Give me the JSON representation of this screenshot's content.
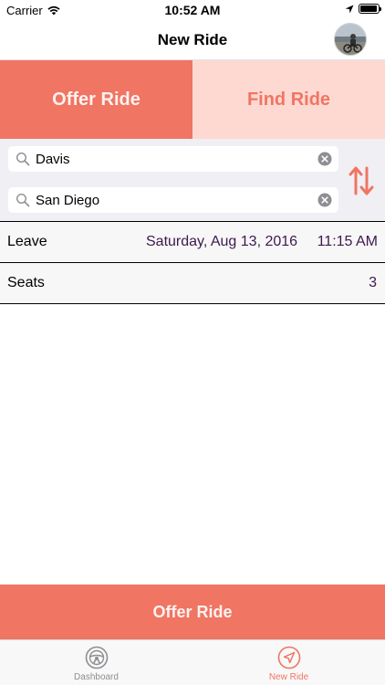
{
  "status_bar": {
    "carrier": "Carrier",
    "time": "10:52 AM",
    "battery_level": 0.95
  },
  "nav": {
    "title": "New Ride",
    "avatar_icon": "profile-photo"
  },
  "segment": {
    "offer_label": "Offer Ride",
    "find_label": "Find Ride",
    "selected": "Offer Ride"
  },
  "search": {
    "origin": {
      "value": "Davis"
    },
    "destination": {
      "value": "San Diego"
    },
    "swap_icon": "swap-arrows-icon"
  },
  "leave": {
    "label": "Leave",
    "date": "Saturday, Aug 13, 2016",
    "time": "11:15 AM"
  },
  "seats": {
    "label": "Seats",
    "value": "3"
  },
  "action": {
    "label": "Offer Ride"
  },
  "tabs": [
    {
      "label": "Dashboard",
      "icon": "steering-wheel-icon"
    },
    {
      "label": "New Ride",
      "icon": "navigation-arrow-icon"
    }
  ],
  "colors": {
    "accent": "#f07563",
    "accent_light": "#fdd9d2",
    "value_text": "#3c1a4d"
  }
}
